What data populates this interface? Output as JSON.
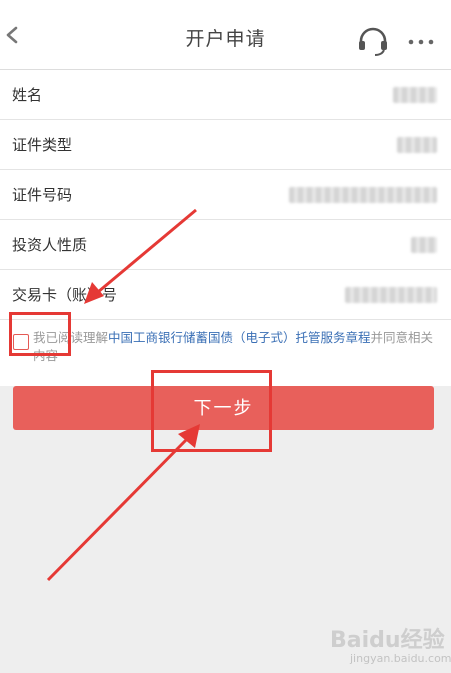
{
  "header": {
    "title": "开户申请",
    "back_icon": "chevron-left-icon",
    "support_icon": "headset-icon",
    "more_icon": "more-dots-icon"
  },
  "form": {
    "rows": [
      {
        "label": "姓名"
      },
      {
        "label": "证件类型"
      },
      {
        "label": "证件号码"
      },
      {
        "label": "投资人性质"
      },
      {
        "label": "交易卡（账）号"
      }
    ]
  },
  "agreement": {
    "prefix": "我已阅读理解",
    "link": "中国工商银行储蓄国债（电子式）托管服务章程",
    "suffix": "并同意相关内容"
  },
  "actions": {
    "next_label": "下一步"
  },
  "watermark": {
    "main": "Baidu经验",
    "sub": "jingyan.baidu.com"
  },
  "colors": {
    "accent": "#e8605b",
    "link": "#3a6fb5",
    "annotation": "#e53935"
  }
}
